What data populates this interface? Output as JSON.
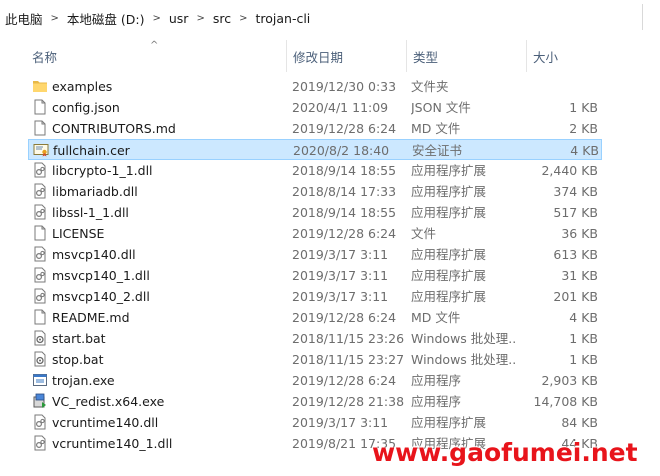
{
  "breadcrumb": [
    "此电脑",
    "本地磁盘 (D:)",
    "usr",
    "src",
    "trojan-cli"
  ],
  "columns": {
    "name": "名称",
    "date": "修改日期",
    "type": "类型",
    "size": "大小"
  },
  "files": [
    {
      "name": "examples",
      "date": "2019/12/30 0:33",
      "type": "文件夹",
      "size": "",
      "icon": "folder-icon"
    },
    {
      "name": "config.json",
      "date": "2020/4/1 11:09",
      "type": "JSON 文件",
      "size": "1 KB",
      "icon": "file-icon"
    },
    {
      "name": "CONTRIBUTORS.md",
      "date": "2019/12/28 6:24",
      "type": "MD 文件",
      "size": "2 KB",
      "icon": "file-icon"
    },
    {
      "name": "fullchain.cer",
      "date": "2020/8/2 18:40",
      "type": "安全证书",
      "size": "4 KB",
      "icon": "certificate-icon",
      "selected": true
    },
    {
      "name": "libcrypto-1_1.dll",
      "date": "2018/9/14 18:55",
      "type": "应用程序扩展",
      "size": "2,440 KB",
      "icon": "dll-icon"
    },
    {
      "name": "libmariadb.dll",
      "date": "2018/8/14 17:33",
      "type": "应用程序扩展",
      "size": "374 KB",
      "icon": "dll-icon"
    },
    {
      "name": "libssl-1_1.dll",
      "date": "2018/9/14 18:55",
      "type": "应用程序扩展",
      "size": "517 KB",
      "icon": "dll-icon"
    },
    {
      "name": "LICENSE",
      "date": "2019/12/28 6:24",
      "type": "文件",
      "size": "36 KB",
      "icon": "file-icon"
    },
    {
      "name": "msvcp140.dll",
      "date": "2019/3/17 3:11",
      "type": "应用程序扩展",
      "size": "613 KB",
      "icon": "dll-icon"
    },
    {
      "name": "msvcp140_1.dll",
      "date": "2019/3/17 3:11",
      "type": "应用程序扩展",
      "size": "31 KB",
      "icon": "dll-icon"
    },
    {
      "name": "msvcp140_2.dll",
      "date": "2019/3/17 3:11",
      "type": "应用程序扩展",
      "size": "201 KB",
      "icon": "dll-icon"
    },
    {
      "name": "README.md",
      "date": "2019/12/28 6:24",
      "type": "MD 文件",
      "size": "4 KB",
      "icon": "file-icon"
    },
    {
      "name": "start.bat",
      "date": "2018/11/15 23:26",
      "type": "Windows 批处理...",
      "size": "1 KB",
      "icon": "batch-icon"
    },
    {
      "name": "stop.bat",
      "date": "2018/11/15 23:27",
      "type": "Windows 批处理...",
      "size": "1 KB",
      "icon": "batch-icon"
    },
    {
      "name": "trojan.exe",
      "date": "2019/12/28 6:24",
      "type": "应用程序",
      "size": "2,903 KB",
      "icon": "exe-icon"
    },
    {
      "name": "VC_redist.x64.exe",
      "date": "2019/12/28 21:38",
      "type": "应用程序",
      "size": "14,708 KB",
      "icon": "installer-icon"
    },
    {
      "name": "vcruntime140.dll",
      "date": "2019/3/17 3:11",
      "type": "应用程序扩展",
      "size": "84 KB",
      "icon": "dll-icon"
    },
    {
      "name": "vcruntime140_1.dll",
      "date": "2019/8/21 17:35",
      "type": "应用程序扩展",
      "size": "44 KB",
      "icon": "dll-icon"
    }
  ],
  "watermark": "www.gaofumei.net"
}
